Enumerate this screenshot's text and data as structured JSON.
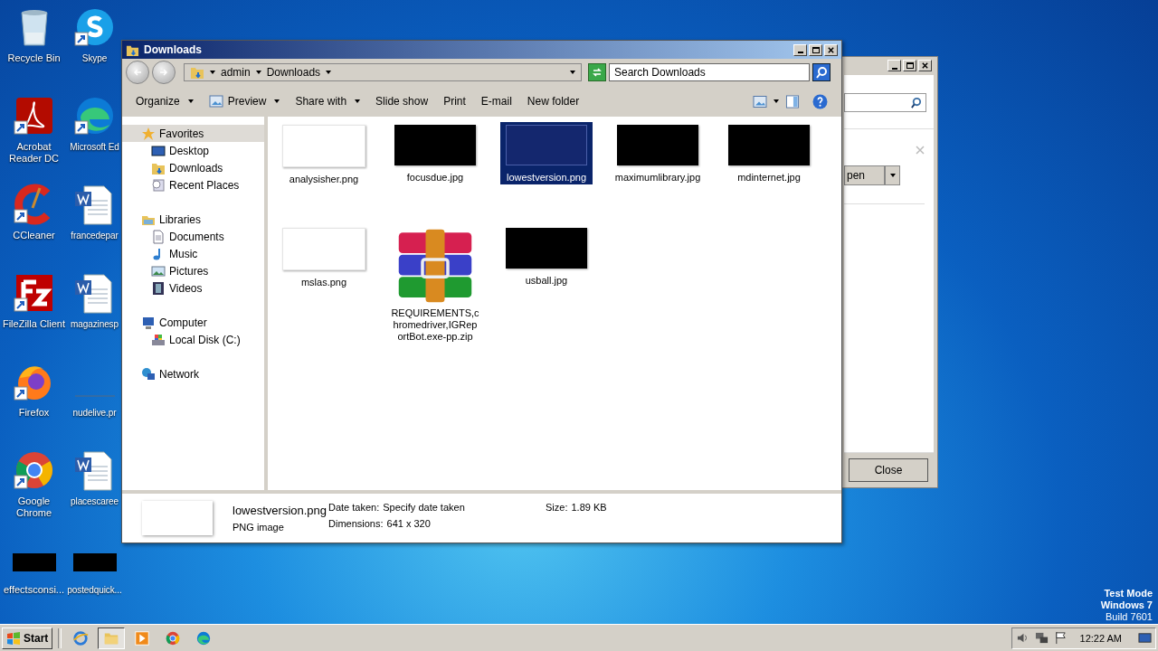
{
  "desktop": {
    "icons": [
      {
        "label": "Recycle Bin",
        "shortcut": false
      },
      {
        "label": "Skype",
        "shortcut": true
      },
      {
        "label": "Acrobat Reader DC",
        "shortcut": true
      },
      {
        "label": "Microsoft Ed",
        "shortcut": true
      },
      {
        "label": "CCleaner",
        "shortcut": true
      },
      {
        "label": "francedepar",
        "shortcut": false
      },
      {
        "label": "FileZilla Client",
        "shortcut": true
      },
      {
        "label": "magazinesp",
        "shortcut": false
      },
      {
        "label": "Firefox",
        "shortcut": true
      },
      {
        "label": "nudelive.pr",
        "shortcut": false
      },
      {
        "label": "Google Chrome",
        "shortcut": true
      },
      {
        "label": "placescaree",
        "shortcut": false
      },
      {
        "label": "effectsconsi...",
        "shortcut": false
      },
      {
        "label": "postedquick...",
        "shortcut": false
      }
    ],
    "watermark": [
      "Test Mode",
      "Windows 7",
      "Build 7601"
    ]
  },
  "back_window": {
    "open_button": "pen",
    "close_button": "Close"
  },
  "window": {
    "title": "Downloads",
    "address": [
      "admin",
      "Downloads"
    ],
    "search": {
      "placeholder": "Search Downloads"
    },
    "toolbar": [
      {
        "label": "Organize",
        "dropdown": true
      },
      {
        "label": "Preview",
        "dropdown": true
      },
      {
        "label": "Share with",
        "dropdown": true
      },
      {
        "label": "Slide show",
        "dropdown": false
      },
      {
        "label": "Print",
        "dropdown": false
      },
      {
        "label": "E-mail",
        "dropdown": false
      },
      {
        "label": "New folder",
        "dropdown": false
      }
    ],
    "sidebar": [
      {
        "label": "Favorites",
        "selected": true,
        "children": [
          {
            "label": "Desktop",
            "selected": false
          },
          {
            "label": "Downloads",
            "selected": false
          },
          {
            "label": "Recent Places",
            "selected": false
          }
        ]
      },
      {
        "label": "Libraries",
        "selected": false,
        "children": [
          {
            "label": "Documents",
            "selected": false
          },
          {
            "label": "Music",
            "selected": false
          },
          {
            "label": "Pictures",
            "selected": false
          },
          {
            "label": "Videos",
            "selected": false
          }
        ]
      },
      {
        "label": "Computer",
        "selected": false,
        "children": [
          {
            "label": "Local Disk (C:)",
            "selected": false
          }
        ]
      },
      {
        "label": "Network",
        "selected": false
      }
    ],
    "files": [
      {
        "name": "analysisher.png",
        "kind": "light-image",
        "selected": false
      },
      {
        "name": "focusdue.jpg",
        "kind": "dark-image",
        "selected": false
      },
      {
        "name": "lowestversion.png",
        "kind": "dark-image",
        "selected": true
      },
      {
        "name": "maximumlibrary.jpg",
        "kind": "dark-image",
        "selected": false
      },
      {
        "name": "mdinternet.jpg",
        "kind": "dark-image",
        "selected": false
      },
      {
        "name": "mslas.png",
        "kind": "light-image",
        "selected": false
      },
      {
        "name": "REQUIREMENTS,chromedriver,IGReportBot.exe-pp.zip",
        "kind": "archive",
        "selected": false
      },
      {
        "name": "usball.jpg",
        "kind": "dark-image",
        "selected": false
      }
    ],
    "details": {
      "name": "lowestversion.png",
      "type": "PNG image",
      "fields": [
        {
          "label": "Date taken:",
          "value": "Specify date taken"
        },
        {
          "label": "Dimensions:",
          "value": "641 x 320"
        },
        {
          "label": "Size:",
          "value": "1.89 KB"
        }
      ]
    }
  },
  "taskbar": {
    "start": "Start",
    "items": [
      {
        "selected": false
      },
      {
        "selected": true
      },
      {
        "selected": false
      },
      {
        "selected": false
      },
      {
        "selected": false
      }
    ],
    "clock": "12:22 AM"
  }
}
